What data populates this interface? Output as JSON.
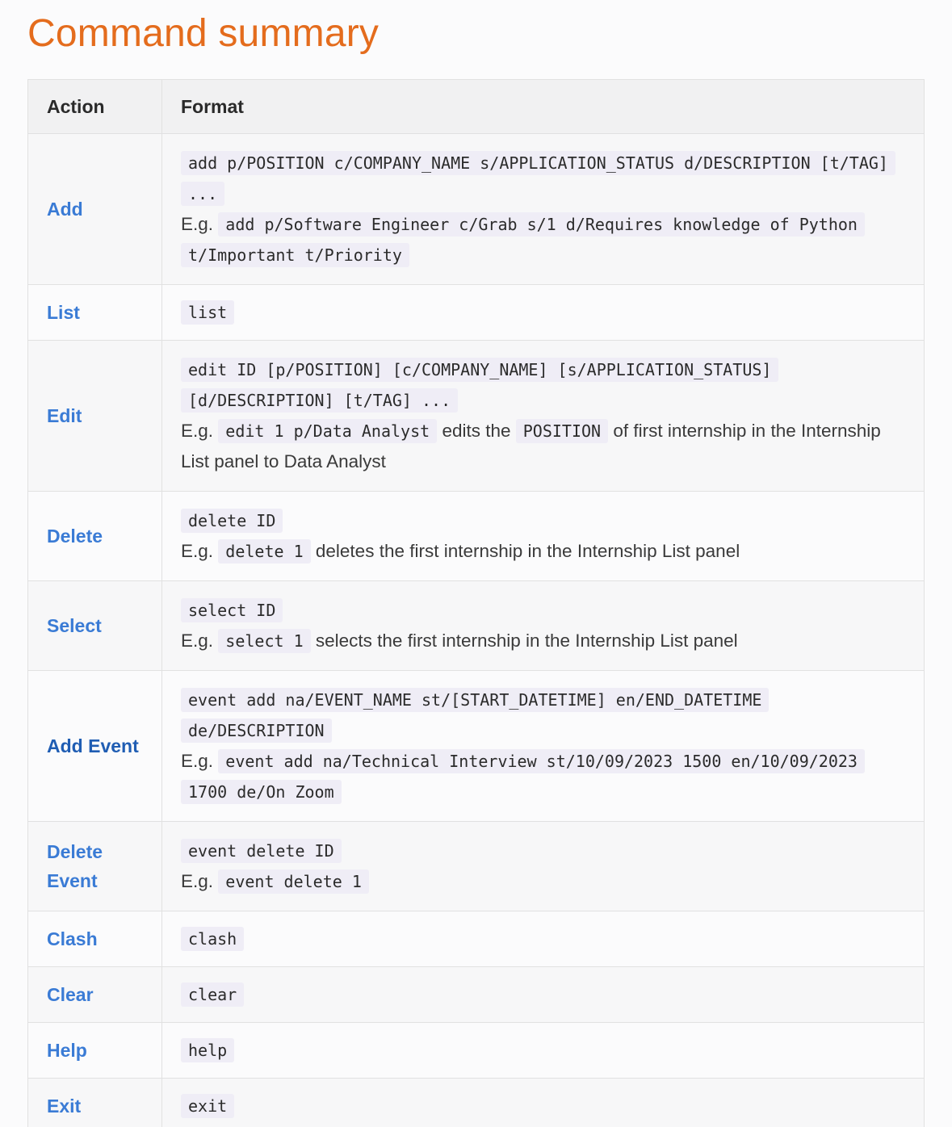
{
  "page_title": "Command summary",
  "table": {
    "headers": [
      "Action",
      "Format"
    ],
    "rows": [
      {
        "action": "Add",
        "format": "add p/POSITION c/COMPANY_NAME s/APPLICATION_STATUS d/DESCRIPTION [t/TAG] ...",
        "eg_prefix": "E.g.",
        "example": "add p/Software Engineer c/Grab s/1 d/Requires knowledge of Python t/Important t/Priority"
      },
      {
        "action": "List",
        "format": "list"
      },
      {
        "action": "Edit",
        "format": "edit ID [p/POSITION] [c/COMPANY_NAME] [s/APPLICATION_STATUS] [d/DESCRIPTION] [t/TAG] ...",
        "eg_prefix": "E.g.",
        "example": "edit 1 p/Data Analyst",
        "desc_1": "edits the",
        "inline_code": "POSITION",
        "desc_2": "of first internship in the Internship List panel to Data Analyst"
      },
      {
        "action": "Delete",
        "format": "delete ID",
        "eg_prefix": "E.g.",
        "example": "delete 1",
        "desc": "deletes the first internship in the Internship List panel"
      },
      {
        "action": "Select",
        "format": "select ID",
        "eg_prefix": "E.g.",
        "example": "select 1",
        "desc": "selects the first internship in the Internship List panel"
      },
      {
        "action": "Add Event",
        "format": "event add na/EVENT_NAME st/[START_DATETIME] en/END_DATETIME de/DESCRIPTION",
        "eg_prefix": "E.g.",
        "example": "event add na/Technical Interview st/10/09/2023 1500 en/10/09/2023 1700 de/On Zoom"
      },
      {
        "action": "Delete Event",
        "format": "event delete ID",
        "eg_prefix": "E.g.",
        "example": "event delete 1"
      },
      {
        "action": "Clash",
        "format": "clash"
      },
      {
        "action": "Clear",
        "format": "clear"
      },
      {
        "action": "Help",
        "format": "help"
      },
      {
        "action": "Exit",
        "format": "exit"
      }
    ]
  },
  "colors": {
    "title": "#e46c1d",
    "action_link": "#3a7bd5",
    "code_bg": "#efedf6",
    "header_bg": "#f1f1f2"
  }
}
